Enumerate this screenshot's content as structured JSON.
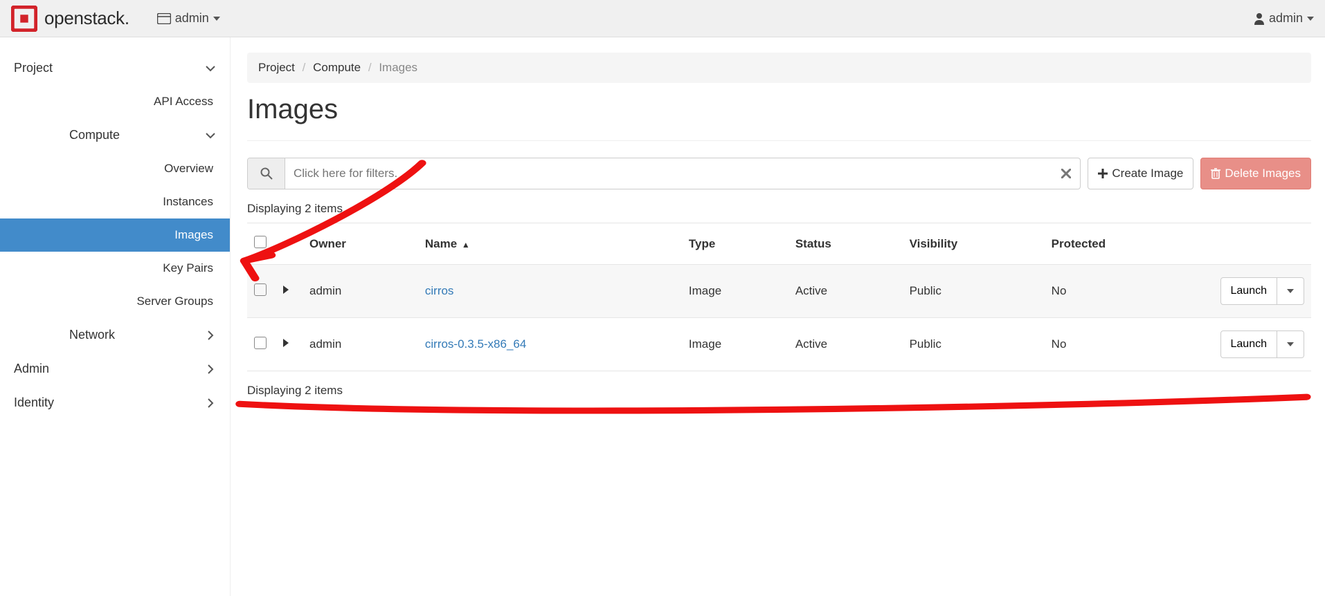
{
  "brand": {
    "name": "openstack."
  },
  "topnav": {
    "project_label": "admin",
    "user_label": "admin"
  },
  "sidebar": {
    "project": {
      "label": "Project",
      "api_access": "API Access",
      "compute": {
        "label": "Compute",
        "overview": "Overview",
        "instances": "Instances",
        "images": "Images",
        "key_pairs": "Key Pairs",
        "server_groups": "Server Groups"
      },
      "network": "Network"
    },
    "admin": "Admin",
    "identity": "Identity"
  },
  "breadcrumb": {
    "b0": "Project",
    "b1": "Compute",
    "b2": "Images"
  },
  "page_title": "Images",
  "toolbar": {
    "search_placeholder": "Click here for filters.",
    "create_label": "Create Image",
    "delete_label": "Delete Images"
  },
  "table": {
    "displaying_top": "Displaying 2 items",
    "displaying_bottom": "Displaying 2 items",
    "headers": {
      "owner": "Owner",
      "name": "Name",
      "type": "Type",
      "status": "Status",
      "visibility": "Visibility",
      "protected": "Protected"
    },
    "launch_label": "Launch",
    "rows": [
      {
        "owner": "admin",
        "name": "cirros",
        "type": "Image",
        "status": "Active",
        "visibility": "Public",
        "protected": "No"
      },
      {
        "owner": "admin",
        "name": "cirros-0.3.5-x86_64",
        "type": "Image",
        "status": "Active",
        "visibility": "Public",
        "protected": "No"
      }
    ]
  }
}
